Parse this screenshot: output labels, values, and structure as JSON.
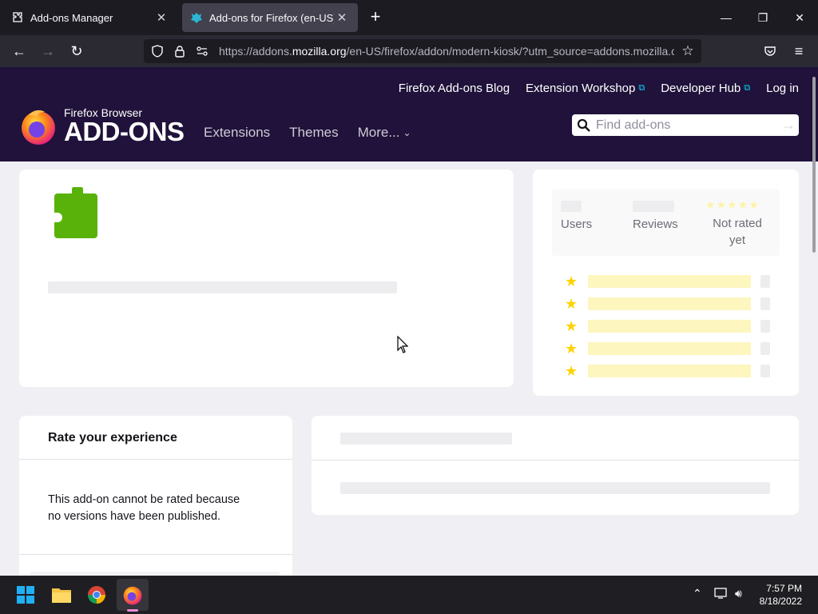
{
  "browser": {
    "tabs": [
      {
        "title": "Add-ons Manager",
        "icon": "puzzle-icon",
        "active": false
      },
      {
        "title": "Add-ons for Firefox (en-US)",
        "icon": "amo-icon",
        "active": true
      }
    ],
    "url_prefix": "https://addons.",
    "url_host": "mozilla.org",
    "url_path": "/en-US/firefox/addon/modern-kiosk/?utm_source=addons.mozilla.o"
  },
  "amo": {
    "top_links": [
      "Firefox Add-ons Blog",
      "Extension Workshop",
      "Developer Hub",
      "Log in"
    ],
    "logo_sub": "Firefox Browser",
    "logo_main": "ADD-ONS",
    "nav": [
      "Extensions",
      "Themes",
      "More..."
    ],
    "search_placeholder": "Find add-ons"
  },
  "meta": {
    "users_label": "Users",
    "reviews_label": "Reviews",
    "rating_label_1": "Not rated",
    "rating_label_2": "yet"
  },
  "rate": {
    "title": "Rate your experience",
    "message_1": "This add-on cannot be rated because",
    "message_2": "no versions have been published."
  },
  "taskbar": {
    "time": "7:57 PM",
    "date": "8/18/2022"
  },
  "colors": {
    "amo_header": "#20123a",
    "puzzle_green": "#58b20a",
    "star_yellow": "#ffd300",
    "link_external": "#00ddff"
  }
}
